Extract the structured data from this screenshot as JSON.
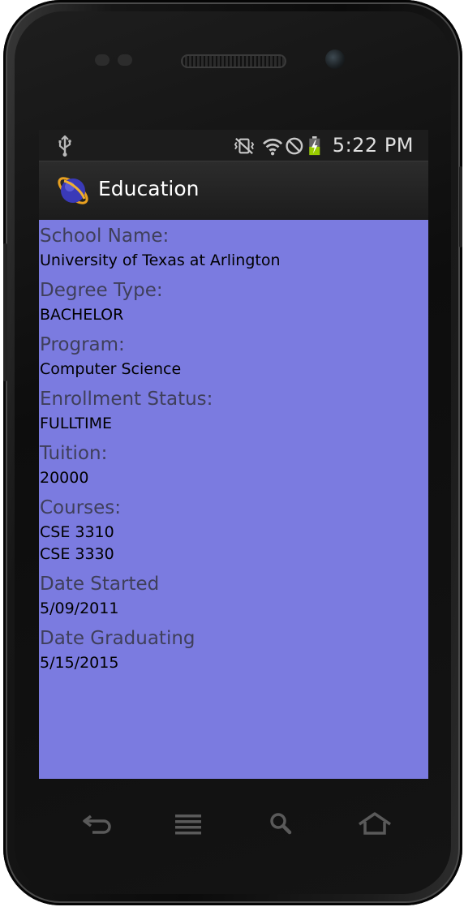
{
  "status_bar": {
    "time": "5:22 PM",
    "icons": [
      "usb-icon",
      "vibrate-icon",
      "wifi-icon",
      "no-signal-icon",
      "battery-charging-icon"
    ]
  },
  "action_bar": {
    "title": "Education",
    "logo_icon": "app-logo-icon"
  },
  "fields": {
    "school_name": {
      "label": "School Name:",
      "value": "University of Texas at Arlington"
    },
    "degree_type": {
      "label": "Degree Type:",
      "value": "BACHELOR"
    },
    "program": {
      "label": "Program:",
      "value": "Computer Science"
    },
    "enrollment_status": {
      "label": "Enrollment Status:",
      "value": "FULLTIME"
    },
    "tuition": {
      "label": "Tuition:",
      "value": "20000"
    },
    "courses": {
      "label": "Courses:",
      "values": [
        "CSE 3310",
        "CSE 3330"
      ]
    },
    "date_started": {
      "label": "Date Started",
      "value": "5/09/2011"
    },
    "date_graduating": {
      "label": "Date Graduating",
      "value": "5/15/2015"
    }
  },
  "nav_buttons": [
    "back-icon",
    "menu-icon",
    "search-icon",
    "home-icon"
  ],
  "colors": {
    "content_background": "#7b7be0",
    "label_text": "#3f3f5a",
    "value_text": "#000000",
    "bar_background": "#1c1c1c"
  }
}
